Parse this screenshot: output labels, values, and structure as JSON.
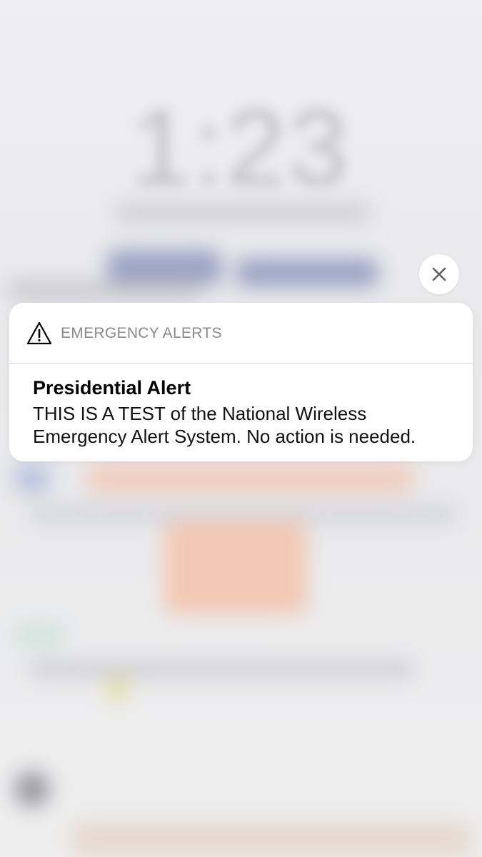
{
  "lock_screen": {
    "time": "1:23"
  },
  "alert": {
    "icon": "warning-triangle-icon",
    "app_name": "EMERGENCY ALERTS",
    "title": "Presidential Alert",
    "message": "THIS IS A TEST of the National Wireless Emergency Alert System. No action is needed."
  },
  "close": {
    "icon": "close-icon"
  },
  "colors": {
    "card_background": "#ffffff",
    "app_name_text": "#8a8a8e",
    "divider": "#d4d4d8",
    "backdrop": "#ececee"
  }
}
